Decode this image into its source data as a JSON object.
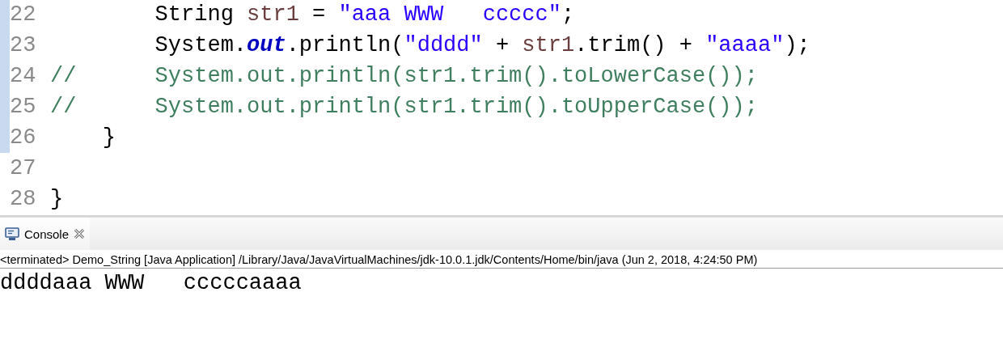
{
  "editor": {
    "lines": [
      {
        "number": "22",
        "changed": true,
        "tokens": [
          {
            "kind": "plain",
            "text": "        String "
          },
          {
            "kind": "variable",
            "text": "str1"
          },
          {
            "kind": "plain",
            "text": " = "
          },
          {
            "kind": "string",
            "text": "\"aaa WWW   ccccc\""
          },
          {
            "kind": "plain",
            "text": ";"
          }
        ]
      },
      {
        "number": "23",
        "changed": true,
        "tokens": [
          {
            "kind": "plain",
            "text": "        System."
          },
          {
            "kind": "static",
            "text": "out"
          },
          {
            "kind": "plain",
            "text": ".println("
          },
          {
            "kind": "string",
            "text": "\"dddd\""
          },
          {
            "kind": "plain",
            "text": " + "
          },
          {
            "kind": "variable",
            "text": "str1"
          },
          {
            "kind": "plain",
            "text": ".trim() + "
          },
          {
            "kind": "string",
            "text": "\"aaaa\""
          },
          {
            "kind": "plain",
            "text": ");"
          }
        ]
      },
      {
        "number": "24",
        "changed": true,
        "tokens": [
          {
            "kind": "comment",
            "text": "//      System.out.println(str1.trim().toLowerCase());"
          }
        ]
      },
      {
        "number": "25",
        "changed": true,
        "tokens": [
          {
            "kind": "comment",
            "text": "//      System.out.println(str1.trim().toUpperCase());"
          }
        ]
      },
      {
        "number": "26",
        "changed": true,
        "tokens": [
          {
            "kind": "plain",
            "text": "    }"
          }
        ]
      },
      {
        "number": "27",
        "changed": false
      },
      {
        "number": "28",
        "changed": false,
        "tokens": [
          {
            "kind": "plain",
            "text": "}"
          }
        ]
      }
    ]
  },
  "console": {
    "tab": {
      "label": "Console"
    },
    "status": "<terminated> Demo_String [Java Application] /Library/Java/JavaVirtualMachines/jdk-10.0.1.jdk/Contents/Home/bin/java (Jun 2, 2018, 4:24:50 PM)",
    "output": [
      "ddddaaa WWW   cccccaaaa"
    ]
  }
}
